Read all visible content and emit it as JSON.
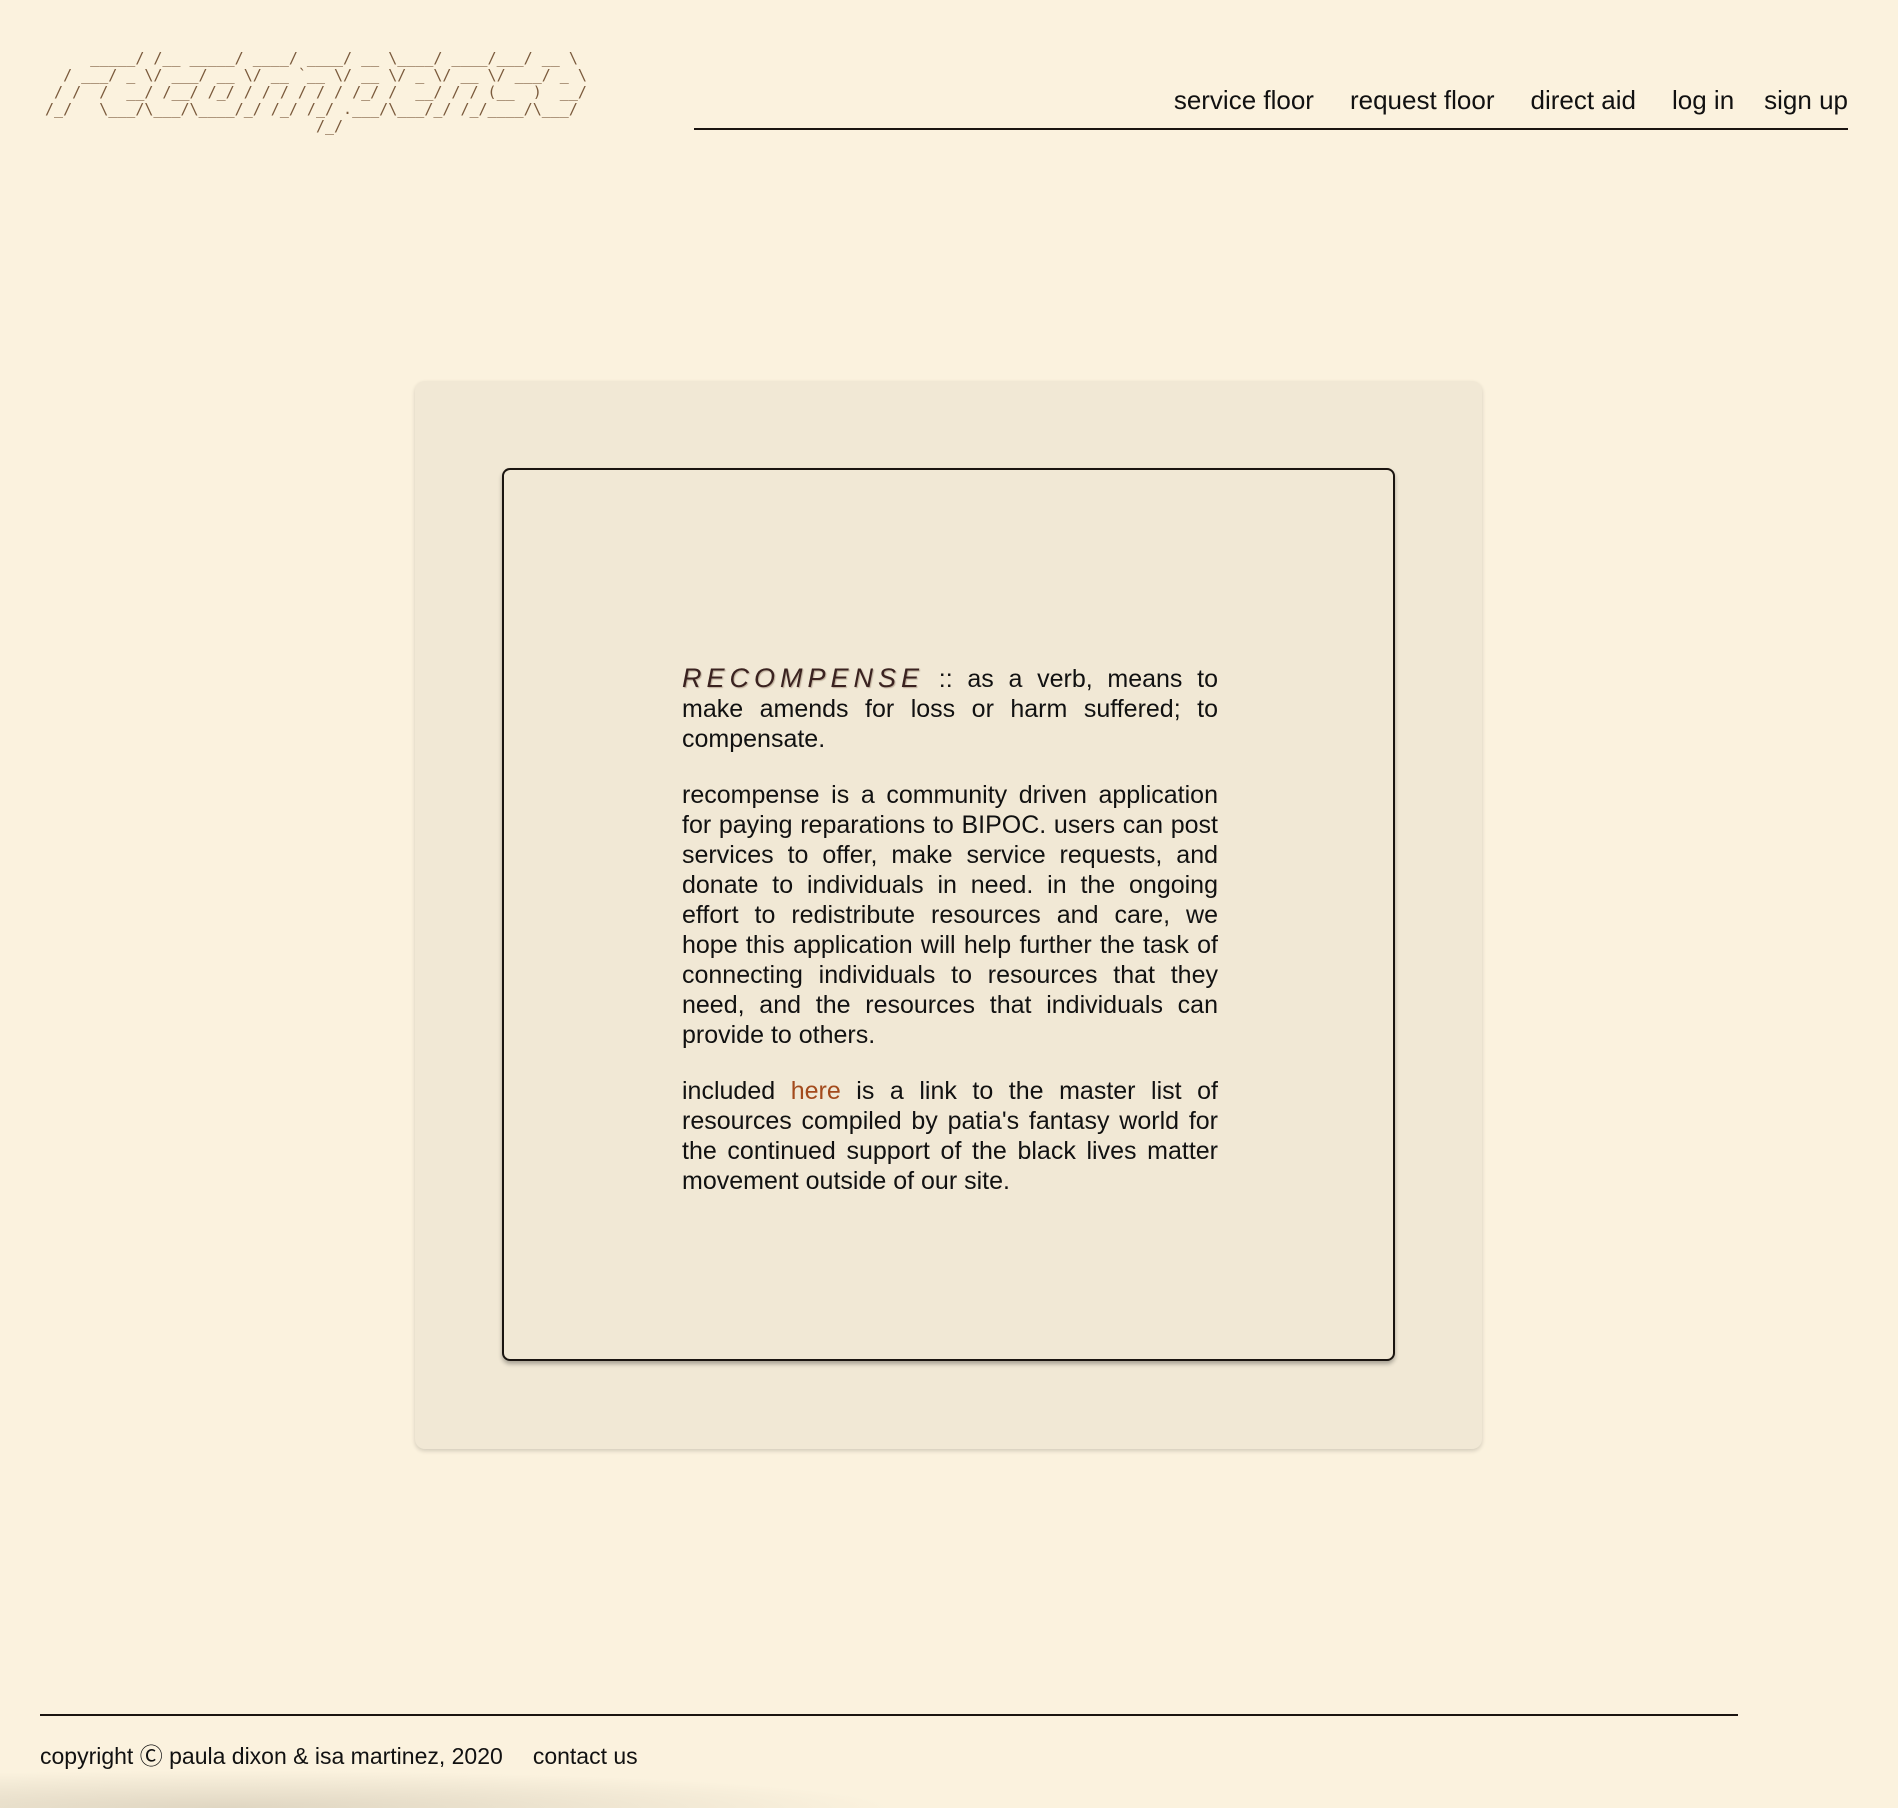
{
  "header": {
    "logo_ascii": "      _____/ /__ _____/ ____/ ____/ __ \\____/ ____/___/ __ \\\n   / ___/ _ \\/ ___/ __ \\/ __ `__ \\/ __ \\/ _ \\/ __ \\/ ___/ _ \\\n  / /  /  __/ /__/ /_/ / / / / / / /_/ /  __/ / / (__  )  __/\n /_/   \\___/\\___/\\____/_/ /_/ /_/ .___/\\___/_/ /_/____/\\___/\n                               /_/",
    "nav": [
      "service floor",
      "request floor",
      "direct aid",
      "log in",
      "sign up"
    ]
  },
  "main": {
    "term": "RECOMPENSE",
    "definition": " :: as a verb, means to make amends for loss or harm suffered; to compensate.",
    "description": "recompense is a community driven application for paying reparations to BIPOC. users can post services to offer, make service requests, and donate to individuals in need. in the ongoing effort to redistribute resources and care, we hope this application will help further the task of connecting individuals to resources that they need, and the resources that individuals can provide to others.",
    "link_prefix": "included ",
    "link_text": "here",
    "link_suffix": " is a link to the master list of resources compiled by patia's fantasy world for the continued support of the black lives matter movement outside of our site."
  },
  "footer": {
    "copyright": "copyright Ⓒ paula dixon & isa martinez, 2020",
    "contact": "contact us"
  },
  "colors": {
    "background": "#fbf2de",
    "card": "#f1e8d5",
    "link_accent": "#a34a1c",
    "logo": "#7a5a3c"
  }
}
